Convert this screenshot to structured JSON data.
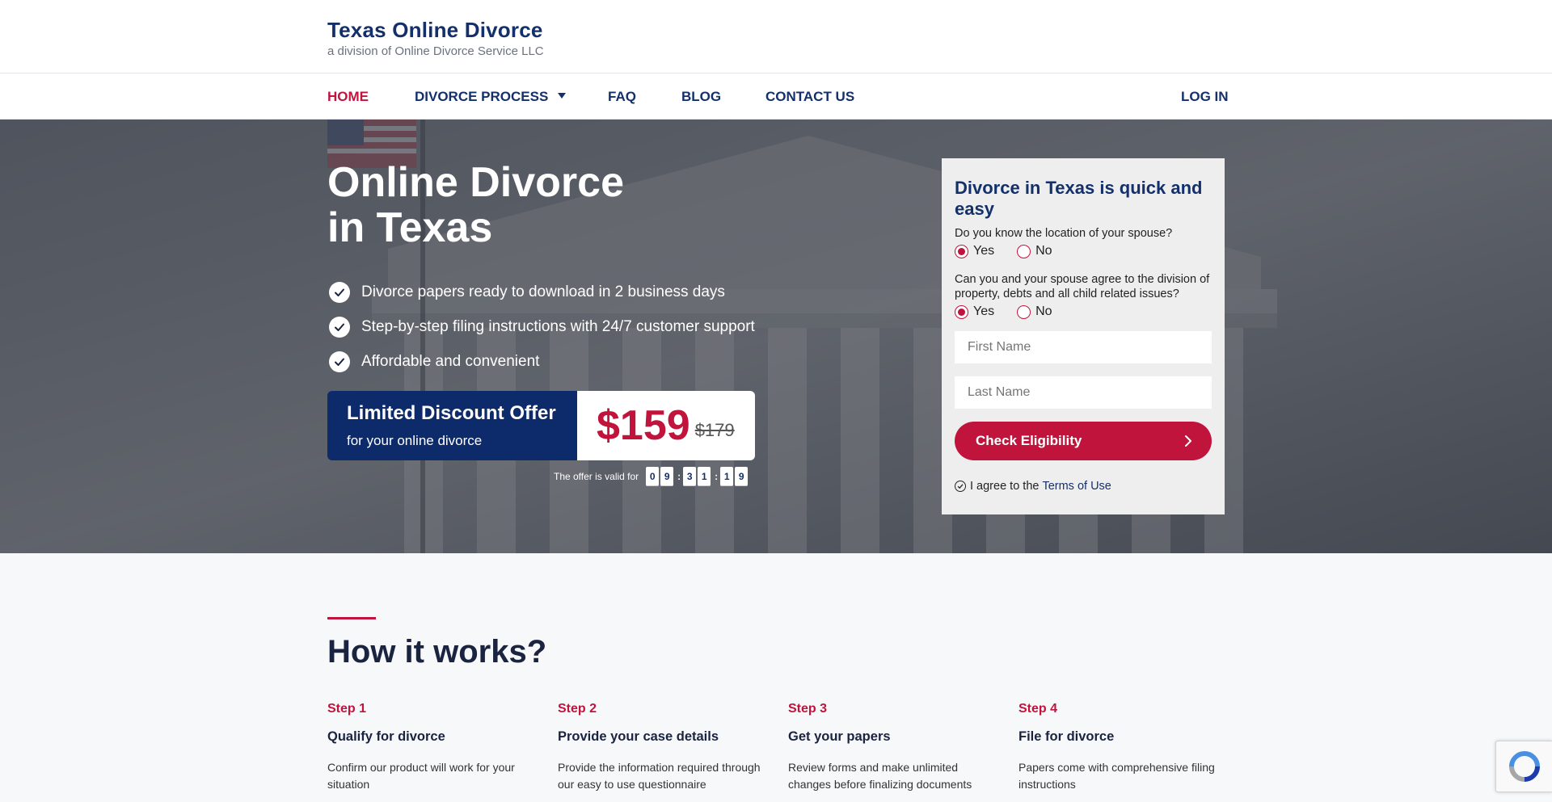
{
  "brand": {
    "title": "Texas Online Divorce",
    "subtitle": "a division of Online Divorce Service LLC"
  },
  "nav": {
    "home": "HOME",
    "process": "DIVORCE PROCESS",
    "faq": "FAQ",
    "blog": "BLOG",
    "contact": "CONTACT US",
    "login": "LOG IN"
  },
  "hero": {
    "title_line1": "Online Divorce",
    "title_line2": "in Texas",
    "features": [
      "Divorce papers ready to download in 2 business days",
      "Step-by-step filing instructions with 24/7 customer support",
      "Affordable and convenient"
    ]
  },
  "offer": {
    "title": "Limited Discount Offer",
    "subtitle": "for your online divorce",
    "price_new": "$159",
    "price_old": "$179",
    "timer_label": "The offer is valid for",
    "timer_digits": [
      "0",
      "9",
      "3",
      "1",
      "1",
      "9"
    ]
  },
  "form": {
    "title": "Divorce in Texas is quick and easy",
    "q1": "Do you know the location of your spouse?",
    "q2": "Can you and your spouse agree to the division of property, debts and all child related issues?",
    "yes": "Yes",
    "no": "No",
    "q1_selected": "Yes",
    "q2_selected": "Yes",
    "first_name_placeholder": "First Name",
    "last_name_placeholder": "Last Name",
    "button": "Check Eligibility",
    "agree_text": "I agree to the",
    "terms_link": "Terms of Use"
  },
  "how": {
    "title": "How it works?",
    "steps": [
      {
        "num": "Step 1",
        "title": "Qualify for divorce",
        "desc": "Confirm our product will work for your situation"
      },
      {
        "num": "Step 2",
        "title": "Provide your case details",
        "desc": "Provide the information required through our easy to use questionnaire"
      },
      {
        "num": "Step 3",
        "title": "Get your papers",
        "desc": "Review forms and make unlimited changes before finalizing documents"
      },
      {
        "num": "Step 4",
        "title": "File for divorce",
        "desc": "Papers come with comprehensive filing instructions"
      }
    ]
  },
  "colors": {
    "navy": "#14306b",
    "red": "#c0143c",
    "offer_bg": "#0d2a6b"
  },
  "icons": {
    "feature": "check-circle-icon",
    "button": "chevron-right-icon",
    "agree": "check-circle-outline-icon",
    "recaptcha": "recaptcha-logo-icon"
  }
}
